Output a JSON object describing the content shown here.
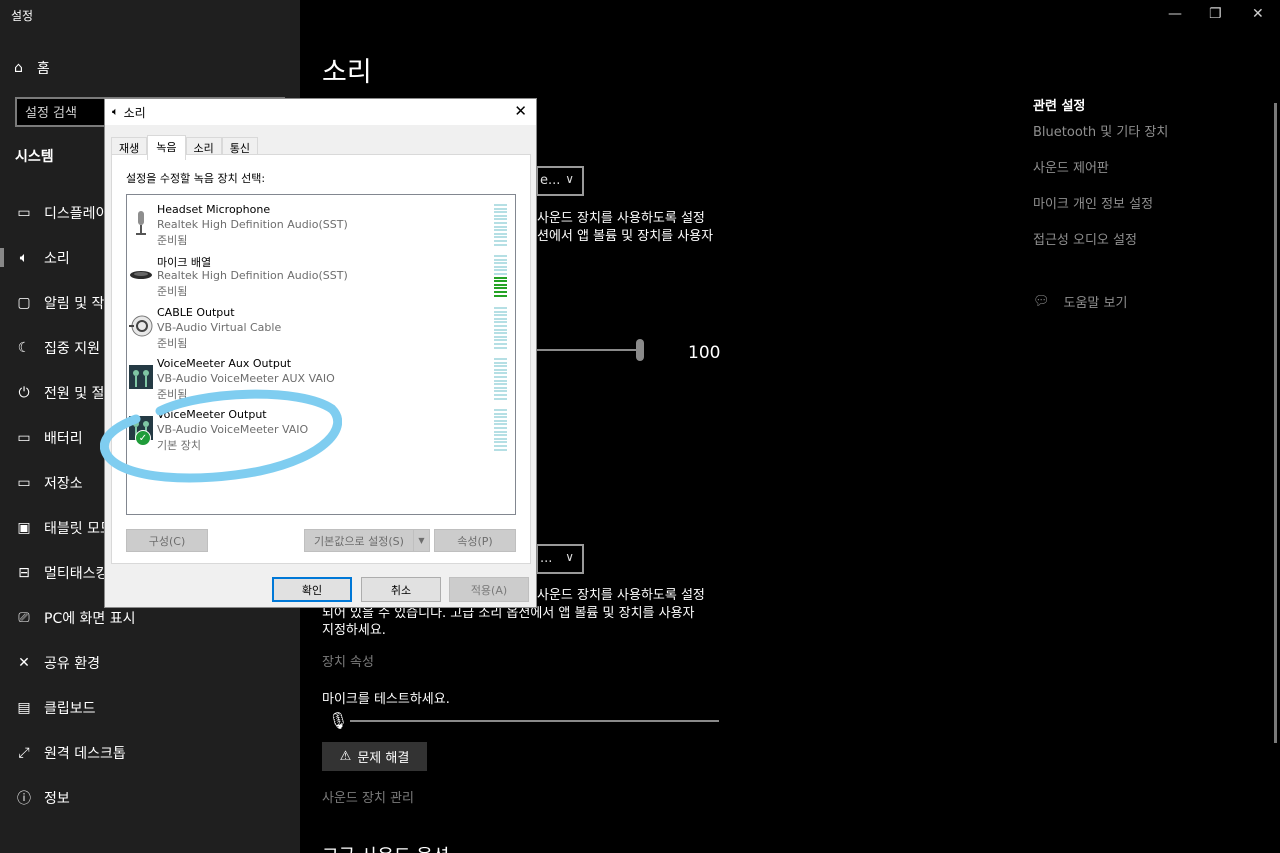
{
  "settings": {
    "app_title": "설정",
    "home_label": "홈",
    "search_placeholder": "설정 검색",
    "section_title": "시스템",
    "nav": [
      {
        "label": "디스플레이",
        "icon": "display-icon"
      },
      {
        "label": "소리",
        "icon": "speaker-icon",
        "active": true
      },
      {
        "label": "알림 및 작업",
        "icon": "notification-icon"
      },
      {
        "label": "집중 지원",
        "icon": "moon-icon"
      },
      {
        "label": "전원 및 절전",
        "icon": "power-icon"
      },
      {
        "label": "배터리",
        "icon": "battery-icon"
      },
      {
        "label": "저장소",
        "icon": "storage-icon"
      },
      {
        "label": "태블릿 모드",
        "icon": "tablet-icon"
      },
      {
        "label": "멀티태스킹",
        "icon": "multitask-icon"
      },
      {
        "label": "PC에 화면 표시",
        "icon": "project-icon"
      },
      {
        "label": "공유 환경",
        "icon": "share-icon"
      },
      {
        "label": "클립보드",
        "icon": "clipboard-icon"
      },
      {
        "label": "원격 데스크톱",
        "icon": "remote-icon"
      },
      {
        "label": "정보",
        "icon": "info-icon"
      }
    ],
    "page_title": "소리",
    "output_dropdown_partial": "e...",
    "output_text_line1": "사운드 장치를 사용하도록 설정",
    "output_text_line2": "션에서 앱 볼륨 및 장치를 사용자",
    "volume_value": "100",
    "input_dropdown_partial": "...",
    "input_text_line1": "사운드 장치를 사용하도록 설정",
    "input_text_line2": "되어 있을 수 있습니다. 고급 소리 옵션에서 앱 볼륨 및 장치를 사용자",
    "input_text_line3": "지정하세요.",
    "device_properties_link": "장치 속성",
    "mic_test_label": "마이크를 테스트하세요.",
    "troubleshoot_label": "문제 해결",
    "manage_devices_link": "사운드 장치 관리",
    "bottom_heading": "고급 사운드 옵션",
    "related": {
      "title": "관련 설정",
      "links": [
        "Bluetooth 및 기타 장치",
        "사운드 제어판",
        "마이크 개인 정보 설정",
        "접근성 오디오 설정"
      ],
      "help": "도움말 보기"
    }
  },
  "dialog": {
    "title": "소리",
    "tabs": [
      "재생",
      "녹음",
      "소리",
      "통신"
    ],
    "active_tab": "녹음",
    "instruction": "설정을 수정할 녹음 장치 선택:",
    "devices": [
      {
        "name": "Headset Microphone",
        "driver": "Realtek High Definition Audio(SST)",
        "status": "준비됨",
        "icon": "headset-mic-icon",
        "level": 0
      },
      {
        "name": "마이크 배열",
        "driver": "Realtek High Definition Audio(SST)",
        "status": "준비됨",
        "icon": "mic-array-icon",
        "level": 0.5
      },
      {
        "name": "CABLE Output",
        "driver": "VB-Audio Virtual Cable",
        "status": "준비됨",
        "icon": "cable-icon",
        "level": 0
      },
      {
        "name": "VoiceMeeter Aux Output",
        "driver": "VB-Audio VoiceMeeter AUX VAIO",
        "status": "준비됨",
        "icon": "voicemeeter-icon",
        "level": 0
      },
      {
        "name": "VoiceMeeter Output",
        "driver": "VB-Audio VoiceMeeter VAIO",
        "status": "기본 장치",
        "icon": "voicemeeter-icon",
        "level": 0,
        "default": true
      }
    ],
    "configure_label": "구성(C)",
    "set_default_label": "기본값으로 설정(S)",
    "properties_label": "속성(P)",
    "ok_label": "확인",
    "cancel_label": "취소",
    "apply_label": "적용(A)"
  },
  "colors": {
    "annotation_ring": "#7fcdf0",
    "meter_idle": "#b5dfe4",
    "meter_active": "#25a325",
    "default_check": "#1f9c3a"
  }
}
